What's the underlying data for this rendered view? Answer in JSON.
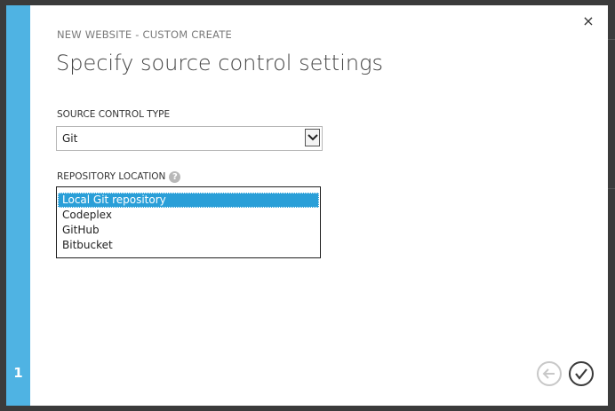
{
  "dialog": {
    "subtitle": "NEW WEBSITE - CUSTOM CREATE",
    "title": "Specify source control settings",
    "step_number": "1",
    "close_symbol": "×"
  },
  "source_control": {
    "label": "SOURCE CONTROL TYPE",
    "selected_value": "Git"
  },
  "repository": {
    "label": "REPOSITORY LOCATION",
    "help_symbol": "?",
    "options": [
      {
        "label": "Local Git repository",
        "selected": true
      },
      {
        "label": "Codeplex",
        "selected": false
      },
      {
        "label": "GitHub",
        "selected": false
      },
      {
        "label": "Bitbucket",
        "selected": false
      }
    ]
  },
  "icons": {
    "close": "close-icon",
    "help": "question-icon",
    "dropdown": "chevron-down-icon",
    "back": "arrow-left-icon",
    "complete": "checkmark-icon"
  },
  "colors": {
    "accent": "#4fb3e3",
    "selection": "#2a9fd8",
    "backdrop": "#3b3b3b"
  }
}
